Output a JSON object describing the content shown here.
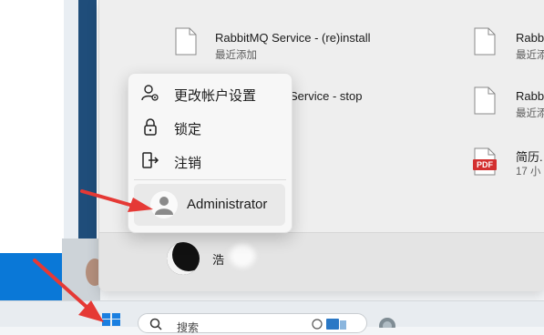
{
  "start_menu": {
    "recommended": [
      {
        "title": "RabbitMQ Service - (re)install",
        "sub": "最近添加",
        "icon": "file-icon"
      },
      {
        "title": "Rabb",
        "sub": "最近添",
        "icon": "file-icon"
      },
      {
        "title": "Service - stop",
        "sub": "",
        "icon": "file-icon"
      },
      {
        "title": "Rabb",
        "sub": "最近添",
        "icon": "file-icon"
      },
      {
        "title": "简历.",
        "sub": "17 小",
        "icon": "pdf-icon",
        "badge": "PDF"
      }
    ],
    "user": {
      "name": "浩"
    }
  },
  "account_flyout": {
    "items": [
      {
        "label": "更改帐户设置",
        "icon": "person-settings-icon"
      },
      {
        "label": "锁定",
        "icon": "lock-icon"
      },
      {
        "label": "注销",
        "icon": "sign-out-icon"
      }
    ],
    "user_label": "Administrator"
  },
  "taskbar": {
    "search_placeholder": "搜索"
  },
  "colors": {
    "annotation_arrow": "#e53935",
    "pdf_badge": "#d32f2f",
    "start_blue": "#0a78d7"
  }
}
